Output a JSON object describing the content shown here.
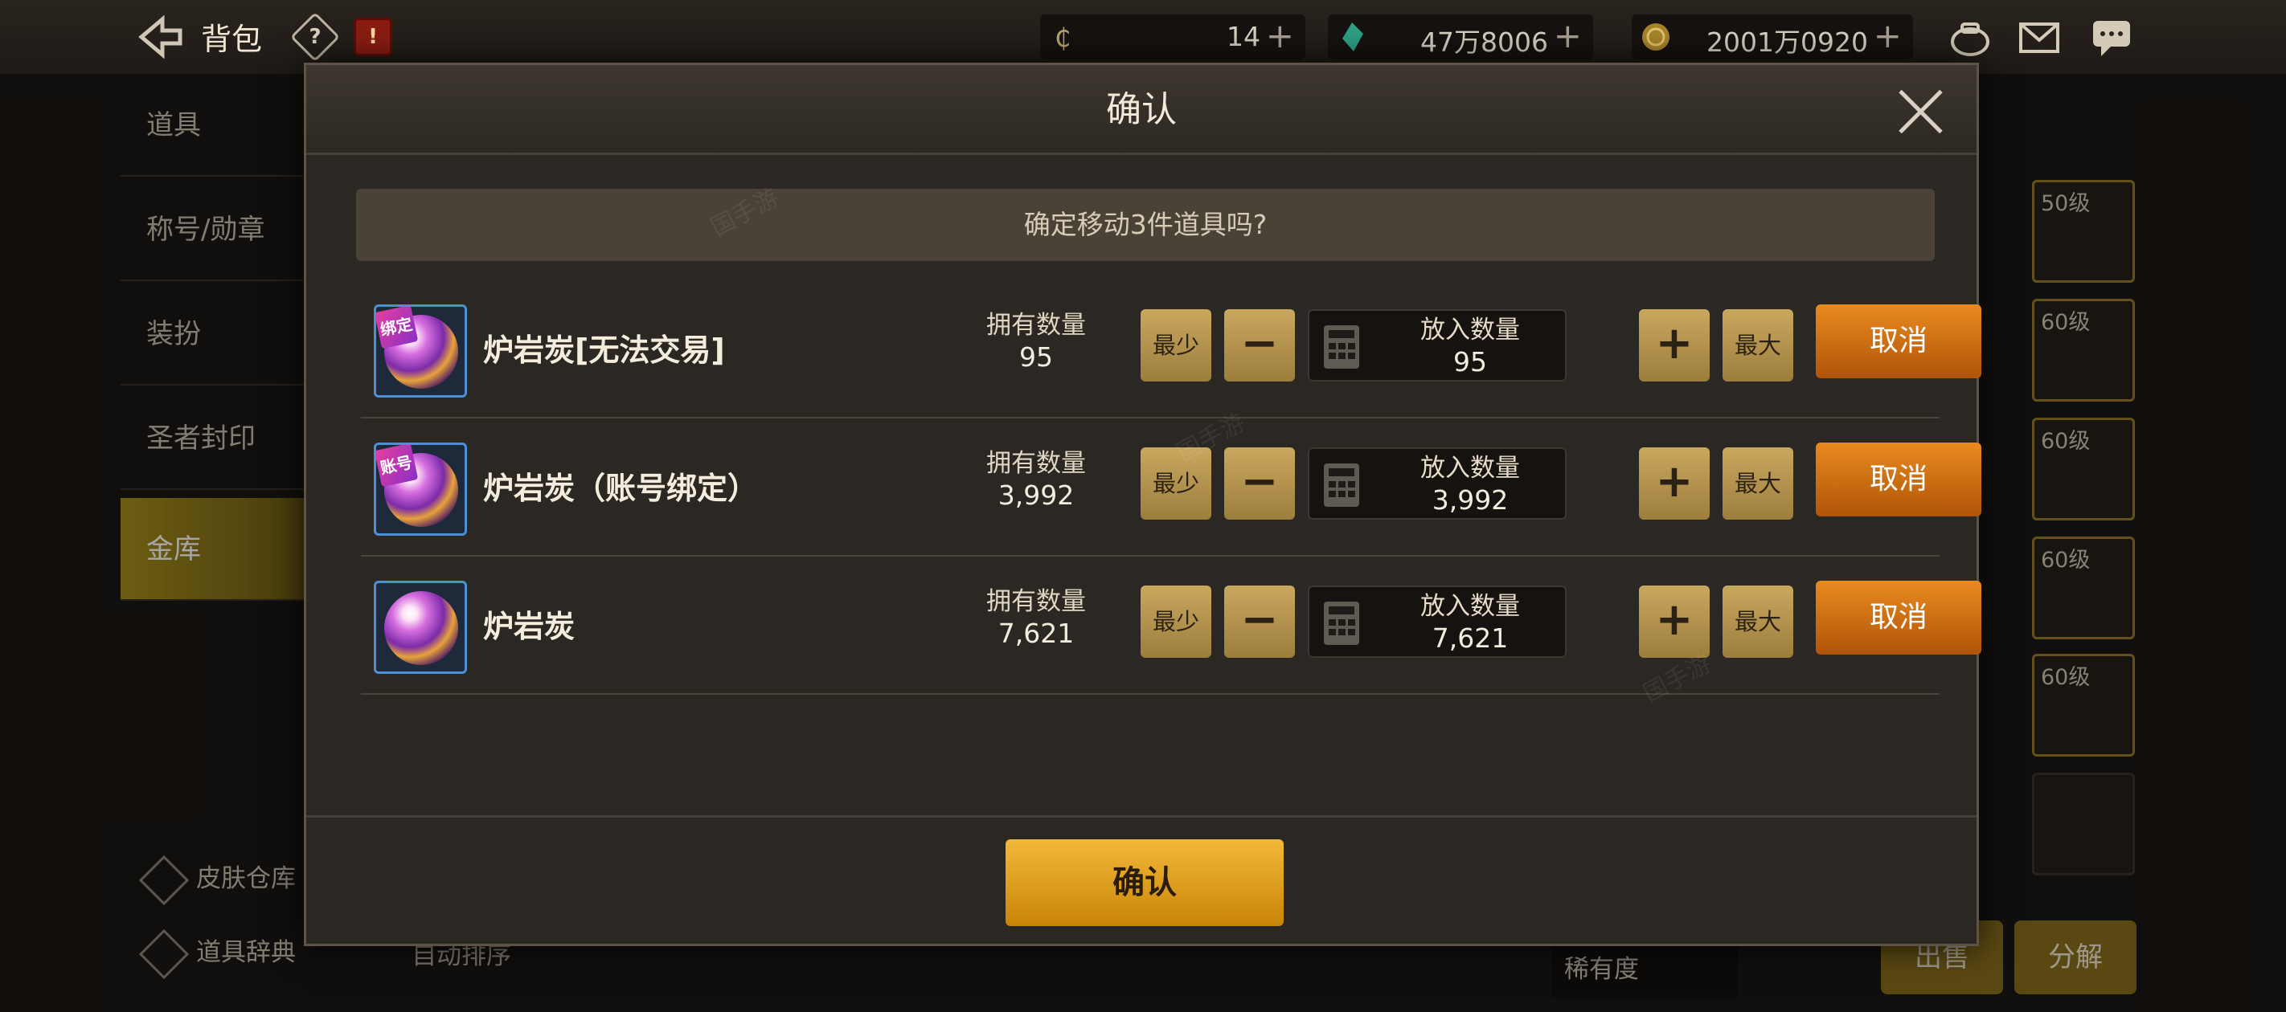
{
  "topbar": {
    "title": "背包",
    "help_glyph": "?",
    "calendar_glyph": "!",
    "currencies": [
      {
        "icon": "c-coin-icon",
        "value": "14"
      },
      {
        "icon": "crystal-icon",
        "value": "47万8006"
      },
      {
        "icon": "gold-coin-icon",
        "value": "2001万0920"
      }
    ],
    "plus": "+"
  },
  "sidebar": {
    "items": [
      {
        "label": "道具"
      },
      {
        "label": "称号/勋章"
      },
      {
        "label": "装扮"
      },
      {
        "label": "圣者封印"
      },
      {
        "label": "金库"
      }
    ],
    "bottom": [
      {
        "label": "皮肤仓库"
      },
      {
        "label": "道具辞典"
      }
    ]
  },
  "background": {
    "auto_sort": "自动排序",
    "rarity": "稀有度",
    "sell": "出售",
    "disassemble": "分解",
    "slot_levels": [
      "50级",
      "60级",
      "60级",
      "60级",
      "60级"
    ]
  },
  "modal": {
    "title": "确认",
    "message": "确定移动3件道具吗?",
    "owned_label": "拥有数量",
    "put_label": "放入数量",
    "min_label": "最少",
    "max_label": "最大",
    "minus": "−",
    "plus": "+",
    "cancel_label": "取消",
    "confirm_label": "确认",
    "items": [
      {
        "name": "炉岩炭[无法交易]",
        "tag": "绑定",
        "owned": "95",
        "put": "95"
      },
      {
        "name": "炉岩炭（账号绑定）",
        "tag": "账号",
        "owned": "3,992",
        "put": "3,992"
      },
      {
        "name": "炉岩炭",
        "tag": "",
        "owned": "7,621",
        "put": "7,621"
      }
    ]
  },
  "watermark": "国手游",
  "colors": {
    "accent_orange": "#e98a1f",
    "confirm_gold": "#f2b83a",
    "icon_border_blue": "#4d8fd6"
  }
}
